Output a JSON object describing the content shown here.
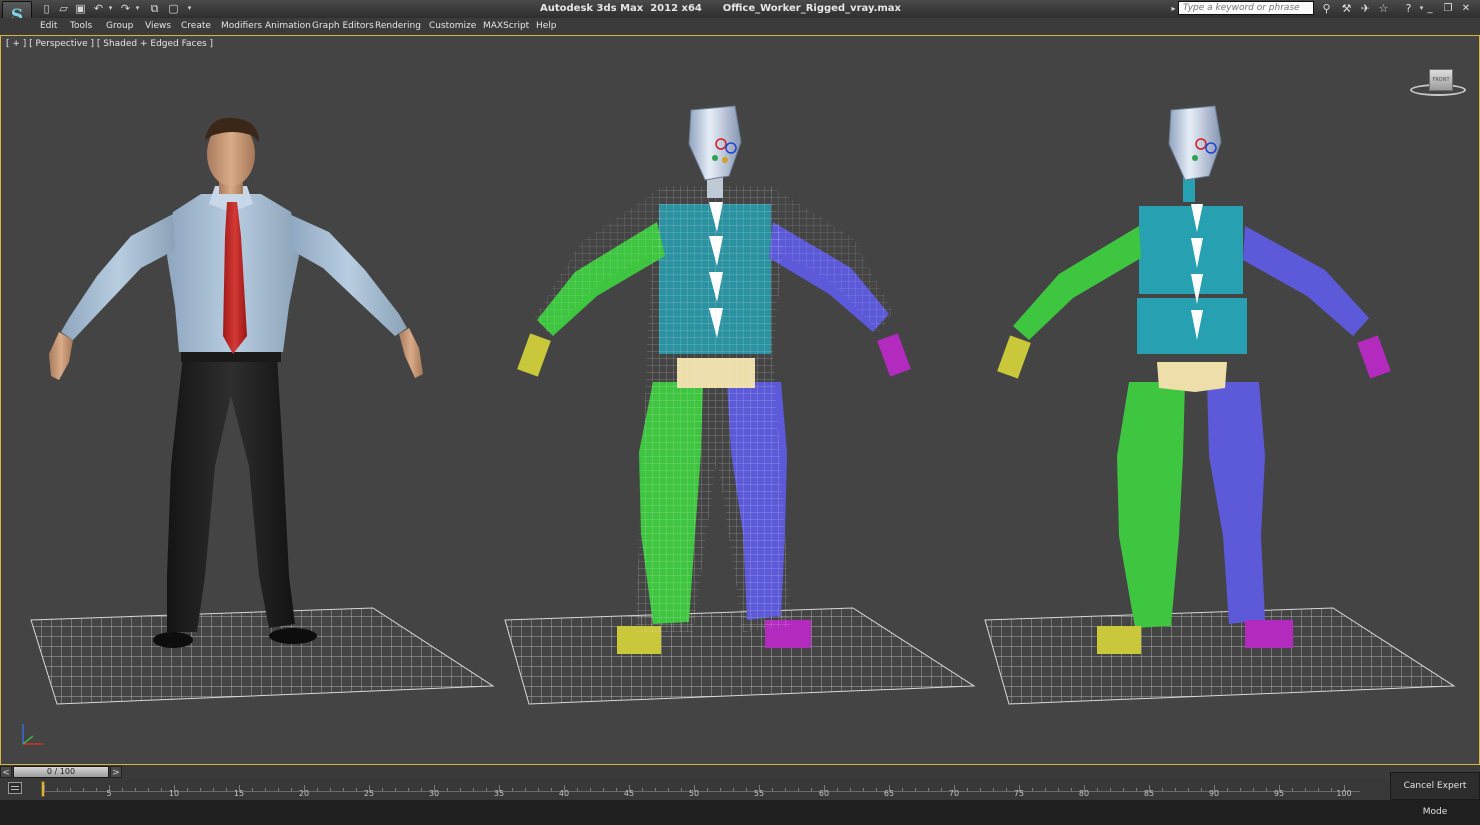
{
  "titlebar": {
    "app_title": "Autodesk 3ds Max  2012 x64      Office_Worker_Rigged_vray.max",
    "search_placeholder": "Type a keyword or phrase",
    "logo_glyph": "S"
  },
  "menubar": {
    "items": [
      "Edit",
      "Tools",
      "Group",
      "Views",
      "Create",
      "Modifiers",
      "Animation",
      "Graph Editors",
      "Rendering",
      "Customize",
      "MAXScript",
      "Help"
    ]
  },
  "viewport": {
    "label": "[ + ] [ Perspective ] [ Shaded + Edged Faces ]",
    "viewcube_face": "FRONT",
    "background_color": "#444444",
    "active_border_color": "#d7b43a"
  },
  "timeline": {
    "slider_label": "0 / 100",
    "prev_glyph": "<",
    "next_glyph": ">",
    "ticks": [
      "5",
      "10",
      "15",
      "20",
      "25",
      "30",
      "35",
      "40",
      "45",
      "50",
      "55",
      "60",
      "65",
      "70",
      "75",
      "80",
      "85",
      "90",
      "95",
      "100"
    ]
  },
  "status": {
    "cancel_expert_mode": "Cancel Expert Mode"
  },
  "rig_colors": {
    "green_limb": "#3fc640",
    "blue_limb": "#5c5ad8",
    "cyan_torso": "#27a0b2",
    "pelvis": "#eedfaa",
    "foot_left": "#c8c83a",
    "foot_right": "#b32bbe"
  }
}
